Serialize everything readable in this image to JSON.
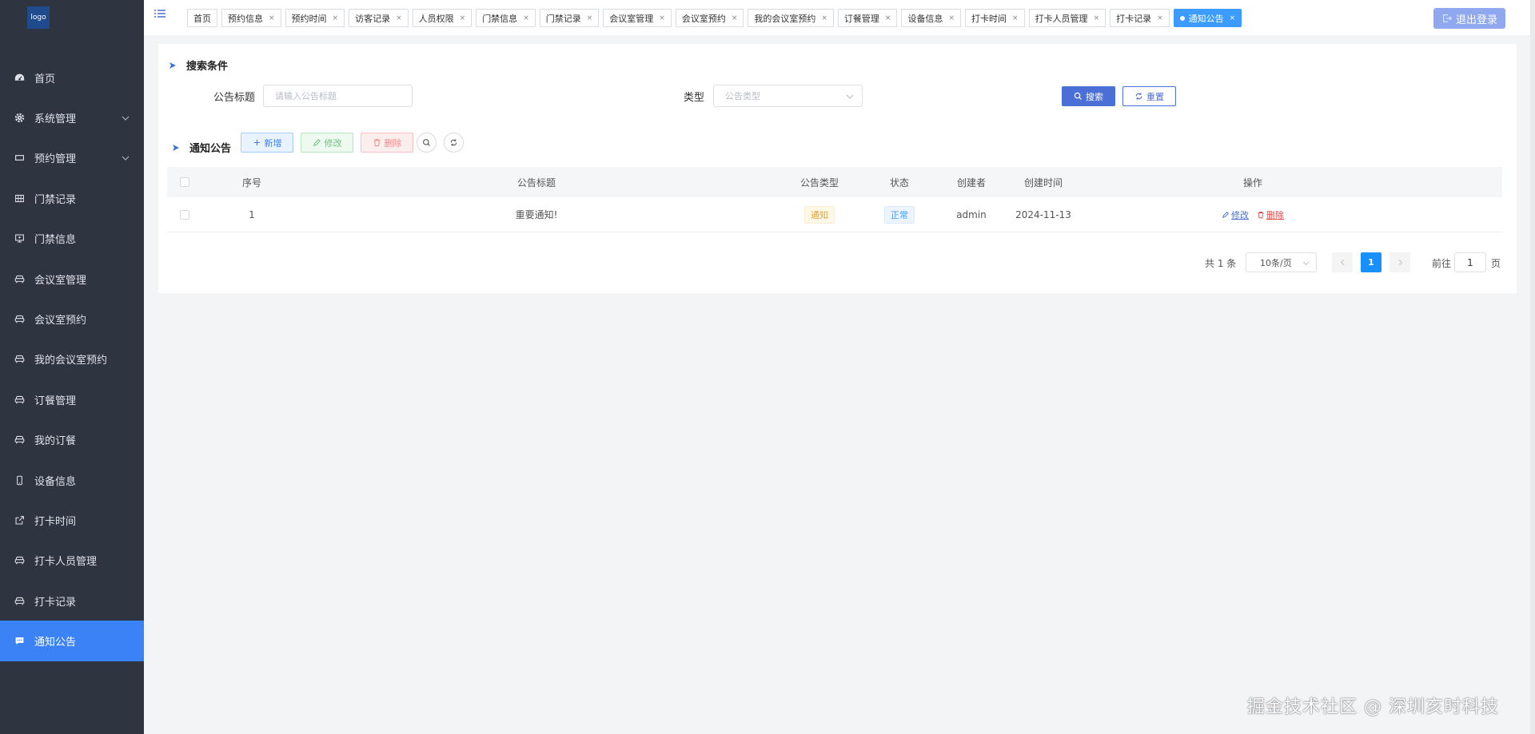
{
  "sidebar": {
    "logo": "logo",
    "items": [
      {
        "label": "首页",
        "icon": "dashboard-icon"
      },
      {
        "label": "系统管理",
        "icon": "gear-icon",
        "has_children": true
      },
      {
        "label": "预约管理",
        "icon": "rectangle-icon",
        "has_children": true
      },
      {
        "label": "门禁记录",
        "icon": "grid-icon"
      },
      {
        "label": "门禁信息",
        "icon": "monitor-icon"
      },
      {
        "label": "会议室管理",
        "icon": "sofa-icon"
      },
      {
        "label": "会议室预约",
        "icon": "sofa-icon"
      },
      {
        "label": "我的会议室预约",
        "icon": "sofa-icon"
      },
      {
        "label": "订餐管理",
        "icon": "sofa-icon"
      },
      {
        "label": "我的订餐",
        "icon": "sofa-icon"
      },
      {
        "label": "设备信息",
        "icon": "mobile-icon"
      },
      {
        "label": "打卡时间",
        "icon": "external-link-icon"
      },
      {
        "label": "打卡人员管理",
        "icon": "sofa-icon"
      },
      {
        "label": "打卡记录",
        "icon": "sofa-icon"
      },
      {
        "label": "通知公告",
        "icon": "message-icon",
        "active": true
      }
    ]
  },
  "topbar": {
    "tags": [
      {
        "label": "首页",
        "closable": false
      },
      {
        "label": "预约信息",
        "closable": true
      },
      {
        "label": "预约时间",
        "closable": true
      },
      {
        "label": "访客记录",
        "closable": true
      },
      {
        "label": "人员权限",
        "closable": true
      },
      {
        "label": "门禁信息",
        "closable": true
      },
      {
        "label": "门禁记录",
        "closable": true
      },
      {
        "label": "会议室管理",
        "closable": true
      },
      {
        "label": "会议室预约",
        "closable": true
      },
      {
        "label": "我的会议室预约",
        "closable": true
      },
      {
        "label": "订餐管理",
        "closable": true
      },
      {
        "label": "设备信息",
        "closable": true
      },
      {
        "label": "打卡时间",
        "closable": true
      },
      {
        "label": "打卡人员管理",
        "closable": true
      },
      {
        "label": "打卡记录",
        "closable": true
      },
      {
        "label": "通知公告",
        "closable": true,
        "active": true
      }
    ],
    "close_glyph": "×",
    "logout_label": "退出登录"
  },
  "search": {
    "section_title": "搜索条件",
    "title_label": "公告标题",
    "title_placeholder": "请输入公告标题",
    "title_value": "",
    "type_label": "类型",
    "type_placeholder": "公告类型",
    "search_button": "搜索",
    "reset_button": "重置"
  },
  "list": {
    "section_title": "通知公告",
    "add_button": "新增",
    "edit_button": "修改",
    "delete_button": "删除"
  },
  "table": {
    "columns": [
      "序号",
      "公告标题",
      "公告类型",
      "状态",
      "创建者",
      "创建时间",
      "操作"
    ],
    "rows": [
      {
        "index": "1",
        "title": "重要通知!",
        "type": "通知",
        "status": "正常",
        "creator": "admin",
        "created": "2024-11-13",
        "edit": "修改",
        "delete": "删除"
      }
    ]
  },
  "pagination": {
    "total_text": "共 1 条",
    "page_size": "10条/页",
    "current_page": "1",
    "goto_label": "前往",
    "goto_value": "1",
    "page_suffix": "页"
  },
  "watermark": "掘金技术社区 @ 深圳亥时科技",
  "colors": {
    "sidebar_bg": "#2e3440",
    "active_menu": "#3b82f6",
    "primary": "#4a6fd6",
    "active_tag": "#3b9bff",
    "logout": "#8fa8f0"
  }
}
